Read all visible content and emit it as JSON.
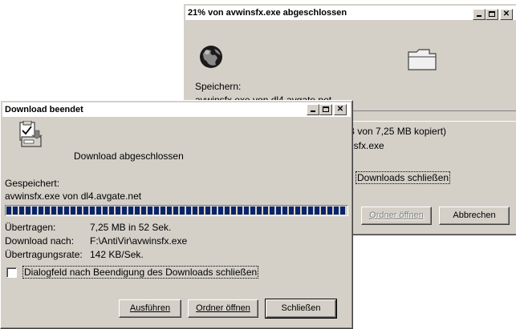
{
  "back_dialog": {
    "title": "21% von avwinsfx.exe abgeschlossen",
    "saving_label": "Speichern:",
    "saving_file_partial": "avwinsfx.exe von dl4.avgate.net",
    "progress_text_partial": "B von 7,25 MB kopiert)",
    "dest_partial": "nsfx.exe",
    "close_after_label_partial": "Downloads schließen",
    "open_folder_label": "Ordner öffnen",
    "cancel_label": "Abbrechen",
    "progress_fraction": 0.21
  },
  "front_dialog": {
    "title": "Download beendet",
    "heading": "Download abgeschlossen",
    "saved_label": "Gespeichert:",
    "saved_value": "avwinsfx.exe von dl4.avgate.net",
    "progress_fraction": 1.0,
    "transferred_label": "Übertragen:",
    "transferred_value": "7,25 MB in 52 Sek.",
    "download_to_label": "Download nach:",
    "download_to_value": "F:\\AntiVir\\avwinsfx.exe",
    "rate_label": "Übertragungsrate:",
    "rate_value": "142 KB/Sek.",
    "checkbox_label": "Dialogfeld nach Beendigung des Downloads schließen",
    "checkbox_checked": false,
    "run_label": "Ausführen",
    "open_folder_label": "Ordner öffnen",
    "close_label": "Schließen"
  },
  "icons": {
    "globe": "globe-icon",
    "folder": "folder-icon",
    "download_complete": "download-complete-icon"
  }
}
